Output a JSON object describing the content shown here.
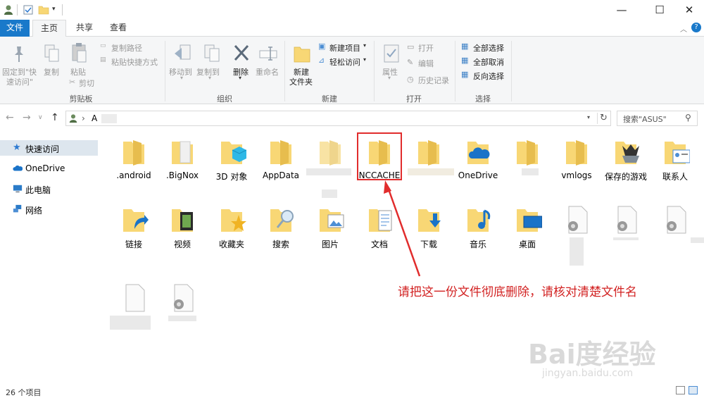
{
  "titlebar": {
    "controls": {
      "minimize": "—",
      "maximize": "☐",
      "close": "✕"
    }
  },
  "tabs": [
    {
      "label": "文件"
    },
    {
      "label": "主页"
    },
    {
      "label": "共享"
    },
    {
      "label": "查看"
    }
  ],
  "ribbon": {
    "clipboard": {
      "pin": "固定到\"快",
      "pin2": "速访问\"",
      "copy": "复制",
      "paste": "粘贴",
      "copy_path": "复制路径",
      "paste_shortcut": "粘贴快捷方式",
      "cut": "剪切",
      "group": "剪贴板"
    },
    "organize": {
      "move_to": "移动到",
      "copy_to": "复制到",
      "delete": "删除",
      "rename": "重命名",
      "group": "组织"
    },
    "new": {
      "new_folder": "新建",
      "new_folder2": "文件夹",
      "new_item": "新建项目",
      "easy_access": "轻松访问",
      "group": "新建"
    },
    "open": {
      "properties": "属性",
      "open": "打开",
      "edit": "编辑",
      "history": "历史记录",
      "group": "打开"
    },
    "select": {
      "select_all": "全部选择",
      "select_none": "全部取消",
      "invert": "反向选择",
      "group": "选择"
    }
  },
  "address": {
    "path_sep": "›",
    "path": "A",
    "search_placeholder": "搜索\"ASUS\""
  },
  "nav": [
    {
      "label": "快速访问"
    },
    {
      "label": "OneDrive"
    },
    {
      "label": "此电脑"
    },
    {
      "label": "网络"
    }
  ],
  "items": [
    {
      "label": ".android"
    },
    {
      "label": ".BigNox"
    },
    {
      "label": "3D 对象"
    },
    {
      "label": "AppData"
    },
    {
      "label": ""
    },
    {
      "label": "NCCACHE"
    },
    {
      "label": ""
    },
    {
      "label": "OneDrive"
    },
    {
      "label": ""
    },
    {
      "label": "vmlogs"
    },
    {
      "label": "保存的游戏"
    },
    {
      "label": "联系人"
    },
    {
      "label": "链接"
    },
    {
      "label": "视频"
    },
    {
      "label": "收藏夹"
    },
    {
      "label": "搜索"
    },
    {
      "label": "图片"
    },
    {
      "label": "文档"
    },
    {
      "label": "下载"
    },
    {
      "label": "音乐"
    },
    {
      "label": "桌面"
    }
  ],
  "annotation": "请把这一份文件彻底删除，请核对清楚文件名",
  "status": {
    "count": "26 个项目"
  },
  "watermark": {
    "brand": "Bai度经验",
    "url": "jingyan.baidu.com"
  },
  "colors": {
    "accent": "#1979ca",
    "annotation": "#d22222",
    "folder": "#f8d775"
  }
}
